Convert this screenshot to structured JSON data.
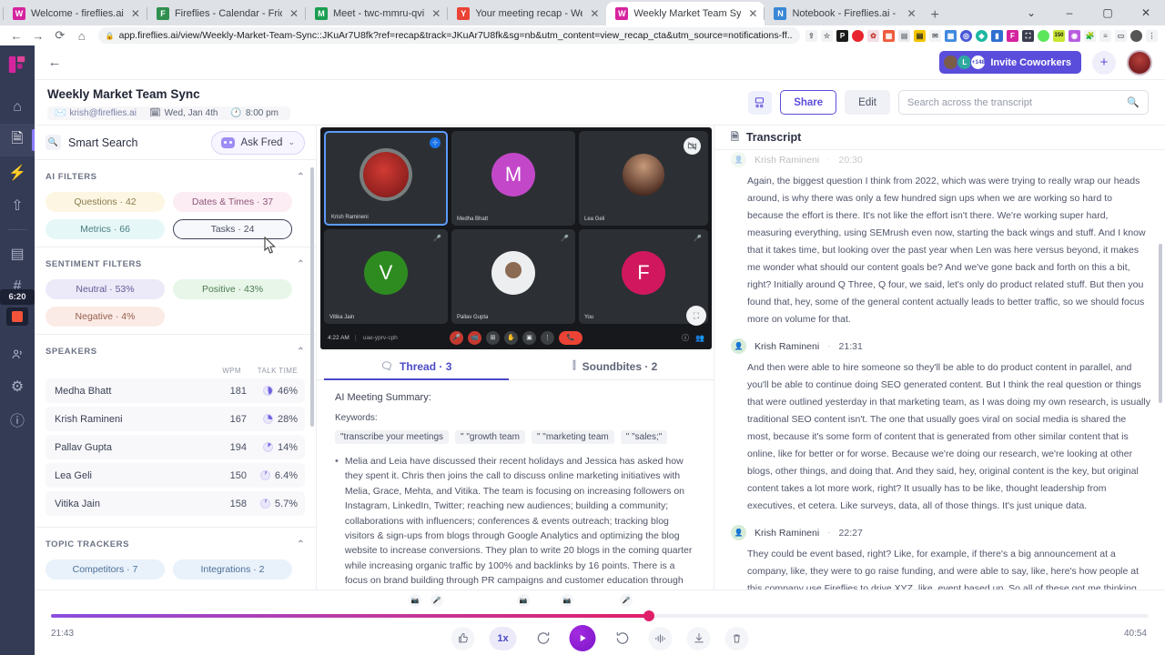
{
  "browser": {
    "tabs": [
      {
        "title": "Welcome - fireflies.ai",
        "favicon": "fireflies-icon",
        "color": "#d6249f",
        "active": false
      },
      {
        "title": "Fireflies - Calendar - Friday, Janu",
        "favicon": "calendar-icon",
        "color": "#2f8f4e",
        "active": false
      },
      {
        "title": "Meet - twc-mmru-qvi",
        "favicon": "meet-icon",
        "color": "#1a9e52",
        "active": false
      },
      {
        "title": "Your meeting recap - Weekly Ma",
        "favicon": "gmail-icon",
        "color": "#ea4335",
        "active": false
      },
      {
        "title": "Weekly Market Team Sync - Mee",
        "favicon": "fireflies-icon",
        "color": "#d6249f",
        "active": true
      },
      {
        "title": "Notebook - Fireflies.ai - Free Me",
        "favicon": "globe-icon",
        "color": "#3a87d6",
        "active": false
      }
    ],
    "new_tab_label": "+",
    "window_controls": [
      "chevron-down-icon",
      "minimize-icon",
      "maximize-icon",
      "close-icon"
    ],
    "nav": {
      "back": "←",
      "forward": "→",
      "reload": "C",
      "home": "⌂"
    },
    "url": "app.fireflies.ai/view/Weekly-Market-Team-Sync::JKuAr7U8fk?ref=recap&track=JKuAr7U8fk&sg=nb&utm_content=view_recap_cta&utm_source=notifications-ff...",
    "lock_icon": "lock-icon",
    "extensions": [
      "share-icon",
      "bookmark-star-icon",
      "pocket-icon",
      "record-icon",
      "grammar-icon",
      "grid-icon",
      "doc-icon",
      "notes-icon",
      "mail-icon",
      "calendar-icon",
      "loom-icon",
      "clipboard-icon",
      "news-icon",
      "fireflies-icon",
      "scan-icon",
      "green-dot-icon",
      "counter-150-icon",
      "purple-ext-icon",
      "puzzle-icon",
      "reading-list-icon",
      "sidepanel-icon",
      "avatar-icon",
      "kebab-icon"
    ]
  },
  "rail": {
    "logo": "fireflies-logo",
    "items": [
      {
        "name": "home-icon",
        "glyph": "⌂",
        "active": false
      },
      {
        "name": "notes-icon",
        "glyph": "🗎",
        "active": true
      },
      {
        "name": "automation-icon",
        "glyph": "⚡",
        "active": false
      },
      {
        "name": "upload-icon",
        "glyph": "⇧",
        "active": false
      },
      {
        "name": "layers-icon",
        "glyph": "▤",
        "active": false
      },
      {
        "name": "channels-icon",
        "glyph": "#",
        "active": false
      },
      {
        "name": "teammates-icon",
        "glyph": "👥",
        "active": false
      },
      {
        "name": "settings-icon",
        "glyph": "⚙",
        "active": false
      },
      {
        "name": "help-icon",
        "glyph": "ⓘ",
        "active": false
      }
    ],
    "recording_timer": "6:20",
    "recording_state": "recording"
  },
  "topbar": {
    "back_label": "←",
    "invite_label": "Invite Coworkers",
    "invite_avatars": [
      "A",
      "L",
      "+148"
    ],
    "add_label": "+",
    "profile": "user-avatar"
  },
  "meeting": {
    "title": "Weekly Market Team Sync",
    "owner": "krish@fireflies.ai",
    "date": "Wed, Jan 4th",
    "time": "8:00 pm",
    "owner_icon": "mail-icon",
    "date_icon": "calendar-icon",
    "time_icon": "clock-icon"
  },
  "header_actions": {
    "assign_icon": "assign-speakers-icon",
    "share_label": "Share",
    "edit_label": "Edit",
    "search_placeholder": "Search across the transcript",
    "search_value": "",
    "search_icon": "search-icon"
  },
  "filters": {
    "smart_search_label": "Smart Search",
    "smart_search_icon": "search-icon",
    "ask_fred_label": "Ask Fred",
    "ask_fred_icon": "robot-icon",
    "ask_fred_caret": "⌄",
    "sections": [
      {
        "title": "AI FILTERS",
        "caret": "⌃",
        "chips": [
          {
            "label": "Questions · 42",
            "bg": "#fdf6e3",
            "fg": "#8a7b4e",
            "selected": false
          },
          {
            "label": "Dates & Times · 37",
            "bg": "#fcecf4",
            "fg": "#8c5878",
            "selected": false
          },
          {
            "label": "Metrics · 66",
            "bg": "#e6f7f7",
            "fg": "#4b7d80",
            "selected": false
          },
          {
            "label": "Tasks · 24",
            "bg": "#f7f8fb",
            "fg": "#3a3f52",
            "selected": true
          }
        ]
      },
      {
        "title": "SENTIMENT FILTERS",
        "caret": "⌃",
        "chips": [
          {
            "label": "Neutral · 53%",
            "bg": "#eceaf8",
            "fg": "#5f5a96",
            "selected": false
          },
          {
            "label": "Positive · 43%",
            "bg": "#e7f6e8",
            "fg": "#4f7b54",
            "selected": false
          },
          {
            "label": "Negative · 4%",
            "bg": "#fbebe6",
            "fg": "#96604f",
            "selected": false
          }
        ]
      }
    ],
    "speakers": {
      "title": "SPEAKERS",
      "caret": "⌃",
      "col_wpm": "WPM",
      "col_talktime": "TALK TIME",
      "rows": [
        {
          "name": "Medha Bhatt",
          "wpm": "181",
          "talk_time": "46%",
          "pct": 46
        },
        {
          "name": "Krish Ramineni",
          "wpm": "167",
          "talk_time": "28%",
          "pct": 28
        },
        {
          "name": "Pallav Gupta",
          "wpm": "194",
          "talk_time": "14%",
          "pct": 14
        },
        {
          "name": "Lea Geli",
          "wpm": "150",
          "talk_time": "6.4%",
          "pct": 6.4
        },
        {
          "name": "Vitika Jain",
          "wpm": "158",
          "talk_time": "5.7%",
          "pct": 5.7
        }
      ]
    },
    "topic_trackers": {
      "title": "TOPIC TRACKERS",
      "caret": "⌃",
      "chips": [
        {
          "label": "Competitors · 7",
          "bg": "#e9f1fb",
          "fg": "#4c6f96"
        },
        {
          "label": "Integrations · 2",
          "bg": "#e9f1fb",
          "fg": "#4c6f96"
        }
      ]
    }
  },
  "video": {
    "participants": [
      {
        "name": "Krish Ramineni",
        "kind": "photo",
        "focused": true,
        "badge": "pin-icon",
        "color": "#b5403a"
      },
      {
        "name": "Medha Bhatt",
        "kind": "initial",
        "initial": "M",
        "color": "#c348c9",
        "badge": ""
      },
      {
        "name": "Lea Geli",
        "kind": "photo",
        "color": "#6b3f33",
        "badge": "camera-off-icon"
      },
      {
        "name": "Vitika Jain",
        "kind": "initial",
        "initial": "V",
        "color": "#2e8b20",
        "badge": "mic-off-icon"
      },
      {
        "name": "Pallav Gupta",
        "kind": "photo",
        "color": "#e8e8e8",
        "badge": "mic-off-icon"
      },
      {
        "name": "You",
        "kind": "initial",
        "initial": "F",
        "color": "#d1185e",
        "badge": "mic-off-icon"
      }
    ],
    "bar_time": "4:22 AM",
    "bar_code": "uae-yprv-cph",
    "bar_buttons": [
      "mic-off-icon",
      "camera-off-icon",
      "present-icon",
      "raise-hand-icon",
      "captions-icon",
      "more-icon",
      "hangup-icon"
    ],
    "bar_right": [
      "info-icon",
      "people-icon"
    ],
    "fullscreen_icon": "fullscreen-icon"
  },
  "center_tabs": [
    {
      "label": "Thread · 3",
      "icon": "thread-icon",
      "active": true
    },
    {
      "label": "Soundbites · 2",
      "icon": "soundbite-icon",
      "active": false
    }
  ],
  "summary": {
    "heading": "AI Meeting Summary:",
    "keywords_label": "Keywords:",
    "keywords": [
      "\"transcribe your meetings",
      "\" \"growth team",
      "\" \"marketing team",
      "\" \"sales;\""
    ],
    "bullets": [
      "Melia and Leia have discussed their recent holidays and Jessica has asked how they spent it. Chris then joins the call to discuss online marketing initiatives with Melia, Grace, Mehta, and Vitika. The team is focusing on increasing followers on Instagram, LinkedIn, Twitter; reaching new audiences; building a community; collaborations with influencers; conferences & events outreach; tracking blog visitors & sign-ups from blogs through Google Analytics and optimizing the blog website to increase conversions. They plan to write 20 blogs in the coming quarter while increasing organic traffic by 100% and backlinks by 16 points. There is a focus on brand building through PR campaigns and customer education through product marketing but there is also discussion about creating original content that"
    ]
  },
  "transcript": {
    "title": "Transcript",
    "icon": "document-icon",
    "entries": [
      {
        "speaker": "Krish Ramineni",
        "time": "20:30",
        "clipped": true,
        "text": "Again, the biggest question I think from 2022, which was were trying to really wrap our heads around, is why there was only a few hundred sign ups when we are working so hard to because the effort is there. It's not like the effort isn't there. We're working super hard, measuring everything, using SEMrush even now, starting the back wings and stuff. And I know that it takes time, but looking over the past year when Len was here versus beyond, it makes me wonder what should our content goals be? And we've gone back and forth on this a bit, right? Initially around Q Three, Q four, we said, let's only do product related stuff. But then you found that, hey, some of the general content actually leads to better traffic, so we should focus more on volume for that."
      },
      {
        "speaker": "Krish Ramineni",
        "time": "21:31",
        "clipped": false,
        "text": "And then were able to hire someone so they'll be able to do product content in parallel, and you'll be able to continue doing SEO generated content. But I think the real question or things that were outlined yesterday in that marketing team, as I was doing my own research, is usually traditional SEO content isn't. The one that usually goes viral on social media is shared the most, because it's some form of content that is generated from other similar content that is online, like for better or for worse. Because we're doing our research, we're looking at other blogs, other things, and doing that. And they said, hey, original content is the key, but original content takes a lot more work, right? It usually has to be like, thought leadership from executives, et cetera. Like surveys, data, all of those things. It's just unique data."
      },
      {
        "speaker": "Krish Ramineni",
        "time": "22:27",
        "clipped": false,
        "text": "They could be event based, right? Like, for example, if there's a big announcement at a company, like, they were to go raise funding, and were able to say, like, here's how people at this company use Fireflies to drive XYZ, like, event based up. So all of these got me thinking about if we had a quarter. And really the end goal is there's a couple of end goals. One is like brand building, customer education, and then driving sign"
      }
    ]
  },
  "player": {
    "current_time": "21:43",
    "total_time": "40:54",
    "progress_pct": 54.5,
    "speed_label": "1x",
    "controls": [
      {
        "name": "thumbs-up-icon",
        "glyph": "👍"
      },
      {
        "name": "playback-speed-button",
        "glyph": "1x"
      },
      {
        "name": "rewind-5-icon",
        "glyph": "↺"
      },
      {
        "name": "play-button",
        "glyph": "▶"
      },
      {
        "name": "forward-15-icon",
        "glyph": "↻"
      },
      {
        "name": "soundbite-icon",
        "glyph": "⋮⋮"
      },
      {
        "name": "download-icon",
        "glyph": "⤓"
      },
      {
        "name": "delete-icon",
        "glyph": "🗑"
      }
    ],
    "markers": [
      {
        "pct": 36.0,
        "icon": "camera-icon"
      },
      {
        "pct": 38.0,
        "icon": "mic-icon"
      },
      {
        "pct": 45.5,
        "icon": "camera-icon"
      },
      {
        "pct": 49.5,
        "icon": "camera-icon"
      },
      {
        "pct": 54.5,
        "icon": "mic-icon"
      }
    ]
  },
  "colors": {
    "brand_purple": "#5b4ddb",
    "rail_bg": "#343b54",
    "accent_pink": "#e01f6a",
    "play_purple": "#8f1fd0"
  }
}
